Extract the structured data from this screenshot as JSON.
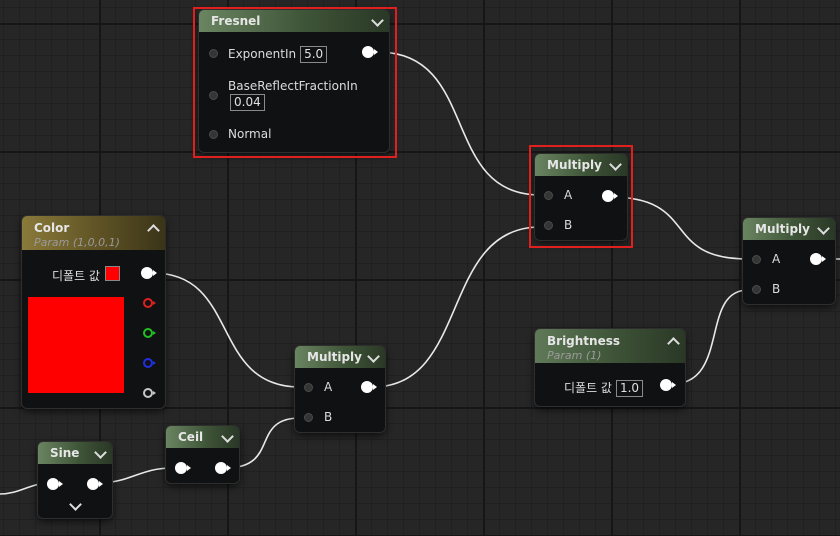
{
  "nodes": {
    "fresnel": {
      "title": "Fresnel",
      "inputs": [
        {
          "label": "ExponentIn",
          "value": "5.0"
        },
        {
          "label": "BaseReflectFractionIn",
          "value": "0.04"
        },
        {
          "label": "Normal"
        }
      ]
    },
    "multiply_top": {
      "title": "Multiply",
      "a": "A",
      "b": "B"
    },
    "multiply_right": {
      "title": "Multiply",
      "a": "A",
      "b": "B"
    },
    "multiply_mid": {
      "title": "Multiply",
      "a": "A",
      "b": "B"
    },
    "color": {
      "title": "Color",
      "subtitle": "Param (1,0,0,1)",
      "default_label": "디폴트 값",
      "swatch_color": "#ff0000"
    },
    "brightness": {
      "title": "Brightness",
      "subtitle": "Param (1)",
      "default_label": "디폴트 값",
      "value": "1.0"
    },
    "ceil": {
      "title": "Ceil"
    },
    "sine": {
      "title": "Sine"
    }
  },
  "colors": {
    "highlight": "#e0201f",
    "channel_r": "#e02020",
    "channel_g": "#20c020",
    "channel_b": "#2030e0",
    "channel_a": "#c8c8c8",
    "wire": "#e8e8e8"
  }
}
